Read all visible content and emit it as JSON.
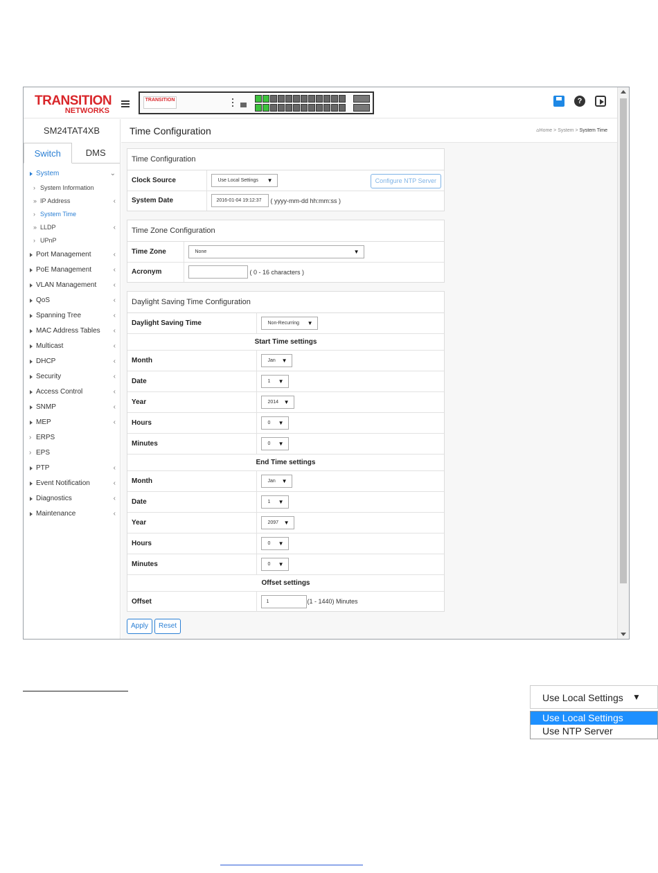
{
  "header": {
    "logo_line1": "TRANSITION",
    "logo_line2": "NETWORKS",
    "mini_logo": "TRANSITION"
  },
  "sidebar": {
    "model": "SM24TAT4XB",
    "tabs": [
      "Switch",
      "DMS"
    ],
    "items": [
      {
        "label": "System",
        "active": true
      },
      {
        "label": "System Information"
      },
      {
        "label": "IP Address"
      },
      {
        "label": "System Time",
        "active": true
      },
      {
        "label": "LLDP"
      },
      {
        "label": "UPnP"
      },
      {
        "label": "Port Management"
      },
      {
        "label": "PoE Management"
      },
      {
        "label": "VLAN Management"
      },
      {
        "label": "QoS"
      },
      {
        "label": "Spanning Tree"
      },
      {
        "label": "MAC Address Tables"
      },
      {
        "label": "Multicast"
      },
      {
        "label": "DHCP"
      },
      {
        "label": "Security"
      },
      {
        "label": "Access Control"
      },
      {
        "label": "SNMP"
      },
      {
        "label": "MEP"
      },
      {
        "label": "ERPS"
      },
      {
        "label": "EPS"
      },
      {
        "label": "PTP"
      },
      {
        "label": "Event Notification"
      },
      {
        "label": "Diagnostics"
      },
      {
        "label": "Maintenance"
      }
    ]
  },
  "page": {
    "title": "Time Configuration",
    "breadcrumb": [
      "Home",
      "System",
      "System Time"
    ]
  },
  "time_config": {
    "title": "Time Configuration",
    "clock_source_label": "Clock Source",
    "clock_source_value": "Use Local Settings",
    "ntp_button": "Configure NTP Server",
    "system_date_label": "System Date",
    "system_date_value": "2016-01-04 19:12:37",
    "system_date_hint": "( yyyy-mm-dd hh:mm:ss )"
  },
  "time_zone": {
    "title": "Time Zone Configuration",
    "zone_label": "Time Zone",
    "zone_value": "None",
    "acronym_label": "Acronym",
    "acronym_value": "",
    "acronym_hint": "( 0 - 16 characters )"
  },
  "dst": {
    "title": "Daylight Saving Time Configuration",
    "dst_label": "Daylight Saving Time",
    "dst_value": "Non-Recurring",
    "start_heading": "Start Time settings",
    "end_heading": "End Time settings",
    "offset_heading": "Offset settings",
    "labels": {
      "month": "Month",
      "date": "Date",
      "year": "Year",
      "hours": "Hours",
      "minutes": "Minutes",
      "offset": "Offset"
    },
    "start": {
      "month": "Jan",
      "date": "1",
      "year": "2014",
      "hours": "0",
      "minutes": "0"
    },
    "end": {
      "month": "Jan",
      "date": "1",
      "year": "2097",
      "hours": "0",
      "minutes": "0"
    },
    "offset_value": "1",
    "offset_hint": "(1 - 1440) Minutes"
  },
  "buttons": {
    "apply": "Apply",
    "reset": "Reset"
  },
  "dropdown_example": {
    "selected": "Use Local Settings",
    "options": [
      "Use Local Settings",
      "Use NTP Server"
    ]
  }
}
